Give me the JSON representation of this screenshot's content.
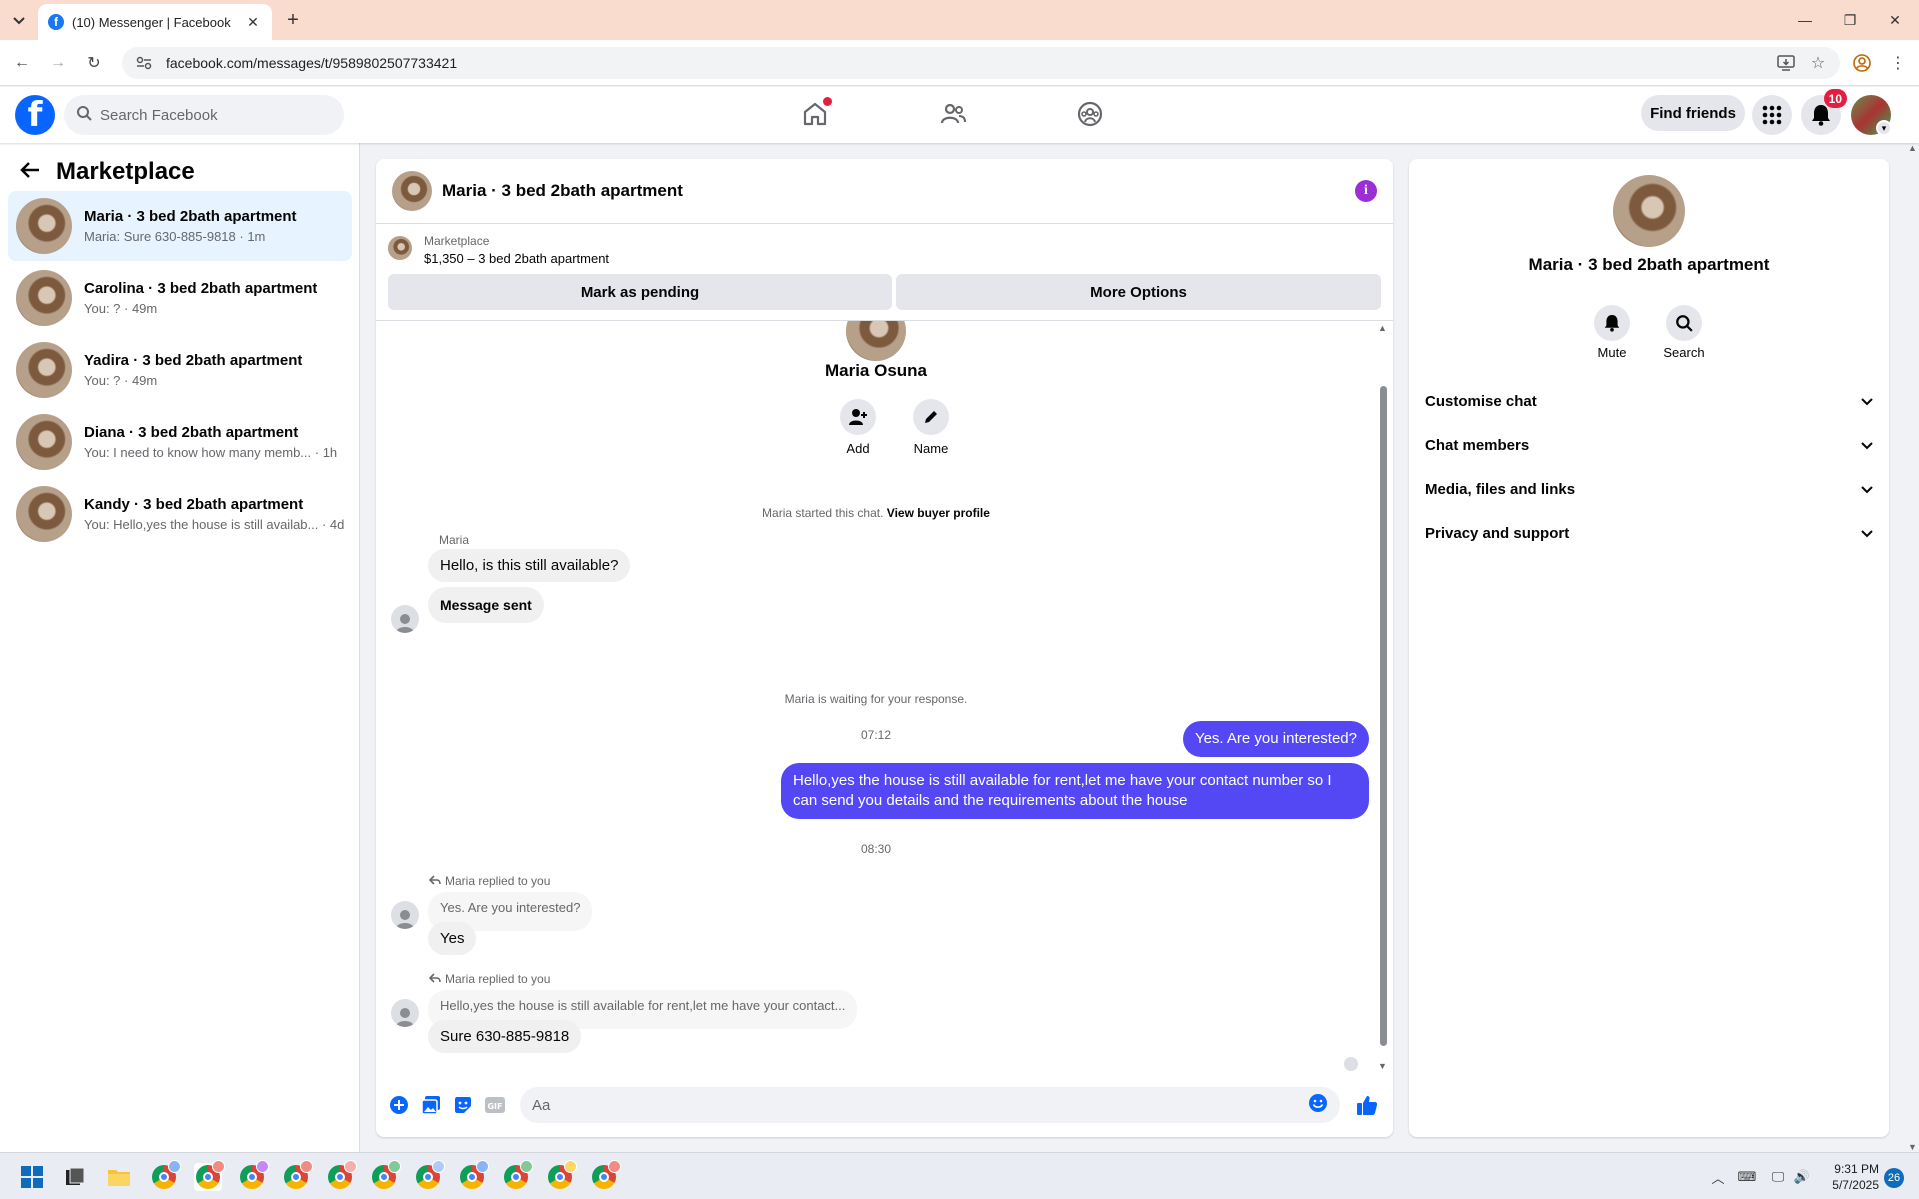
{
  "browser": {
    "tab_title": "(10) Messenger | Facebook",
    "url": "facebook.com/messages/t/9589802507733421"
  },
  "header": {
    "search_placeholder": "Search Facebook",
    "find_friends": "Find friends",
    "notification_count": "10"
  },
  "sidebar": {
    "title": "Marketplace",
    "conversations": [
      {
        "name": "Maria · 3 bed 2bath apartment",
        "preview": "Maria: Sure 630-885-9818 · 1m"
      },
      {
        "name": "Carolina · 3 bed 2bath apartment",
        "preview": "You: ? · 49m"
      },
      {
        "name": "Yadira · 3 bed 2bath apartment",
        "preview": "You: ? · 49m"
      },
      {
        "name": "Diana · 3 bed 2bath apartment",
        "preview": "You: I need to know how many memb... · 1h"
      },
      {
        "name": "Kandy · 3 bed 2bath apartment",
        "preview": "You: Hello,yes the house is still availab... · 4d"
      }
    ]
  },
  "chat": {
    "title": "Maria · 3 bed 2bath apartment",
    "marketplace_label": "Marketplace",
    "listing": "$1,350 – 3 bed 2bath apartment",
    "mark_pending": "Mark as pending",
    "more_options": "More Options",
    "contact_name": "Maria Osuna",
    "add_label": "Add",
    "name_label": "Name",
    "started_text": "Maria started this chat.",
    "buyer_profile_link": "View buyer profile",
    "sender_label": "Maria",
    "msg1": "Hello, is this still available?",
    "msg2": "Message sent",
    "waiting_text": "Maria is waiting for your response.",
    "time1": "07:12",
    "out1": "Yes. Are you interested?",
    "out2": "Hello,yes the house is still available for rent,let me have your contact number   so I can send you details and the requirements about the house",
    "time2": "08:30",
    "reply_label1": "Maria replied to you",
    "quote1": "Yes. Are you interested?",
    "reply1": "Yes",
    "reply_label2": "Maria replied to you",
    "quote2": "Hello,yes the house is still available for rent,let me have your contact...",
    "reply2": "Sure 630-885-9818",
    "composer_placeholder": "Aa"
  },
  "right_panel": {
    "title": "Maria · 3 bed 2bath apartment",
    "mute": "Mute",
    "search": "Search",
    "sections": [
      "Customise chat",
      "Chat members",
      "Media, files and links",
      "Privacy and support"
    ]
  },
  "taskbar": {
    "time": "9:31 PM",
    "date": "5/7/2025",
    "notif": "26"
  },
  "colors": {
    "brand": "#0866ff",
    "outgoing_bubble": "#5448f5",
    "active_conv": "#e7f3ff",
    "badge": "#e41e3f"
  }
}
